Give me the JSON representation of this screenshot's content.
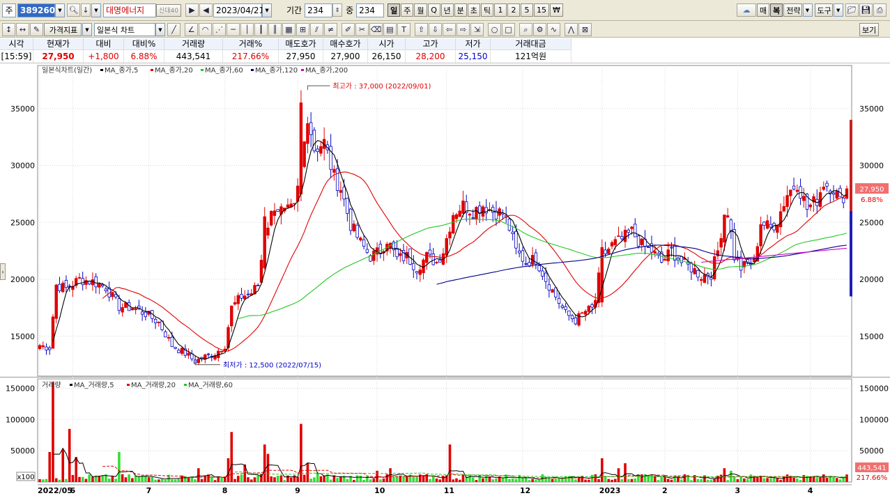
{
  "toolbar1": {
    "market_label": "주",
    "stock_code": "389260",
    "stock_name": "대명에너지",
    "stock_tag": "신대40",
    "date": "2023/04/21",
    "period_label": "기간",
    "period_value": "234",
    "count_label": "중",
    "count_value": "234",
    "intervals": [
      "일",
      "주",
      "월",
      "Q",
      "년",
      "분",
      "초",
      "틱",
      "1",
      "2",
      "5",
      "15",
      "₩"
    ],
    "active_interval": "일",
    "right_buttons": [
      "매",
      "복",
      "전략",
      "도구"
    ]
  },
  "toolbar2": {
    "price_indicator_label": "가격지표",
    "chart_type_label": "일본식 차트",
    "view_button": "보기"
  },
  "quote": {
    "headers": [
      "시각",
      "현재가",
      "대비",
      "대비%",
      "거래량",
      "거래%",
      "매도호가",
      "매수호가",
      "시가",
      "고가",
      "저가",
      "거래대금"
    ],
    "values": [
      "[15:59]",
      "27,950",
      "+1,800",
      "6.88%",
      "443,541",
      "217.66%",
      "27,950",
      "27,900",
      "26,150",
      "28,200",
      "25,150",
      "121억원"
    ]
  },
  "chart_data": [
    {
      "type": "candlestick",
      "title": "일본식차트(일간)",
      "legend": [
        {
          "name": "MA_종가,5",
          "color": "#000000"
        },
        {
          "name": "MA_종가,20",
          "color": "#e00000"
        },
        {
          "name": "MA_종가,60",
          "color": "#22c722"
        },
        {
          "name": "MA_종가,120",
          "color": "#00008b"
        },
        {
          "name": "MA_종가,200",
          "color": "#cc00cc"
        }
      ],
      "ylim": [
        11500,
        37800
      ],
      "y_ticks": [
        15000,
        20000,
        25000,
        30000,
        35000
      ],
      "x_labels": [
        "2022/05",
        "6",
        "7",
        "8",
        "9",
        "10",
        "11",
        "12",
        "2023",
        "2",
        "3",
        "4"
      ],
      "x_label_index": [
        0,
        10,
        33,
        56,
        78,
        102,
        123,
        146,
        170,
        189,
        211,
        233
      ],
      "annotations": {
        "high": "최고가 : 37,000 (2022/09/01)",
        "low": "최저가 : 12,500 (2022/07/15)"
      },
      "current_price_label": "27,950",
      "current_change_label": "6.88%",
      "ma120_start_index": 120,
      "ma200_start_index": 200,
      "anchors": [
        [
          0,
          14200
        ],
        [
          3,
          14000
        ],
        [
          5,
          19500
        ],
        [
          8,
          19200
        ],
        [
          12,
          20000
        ],
        [
          16,
          19800
        ],
        [
          20,
          19300
        ],
        [
          24,
          17600
        ],
        [
          28,
          17500
        ],
        [
          32,
          17000
        ],
        [
          36,
          16200
        ],
        [
          40,
          14200
        ],
        [
          44,
          13500
        ],
        [
          47,
          12800
        ],
        [
          50,
          13200
        ],
        [
          53,
          13500
        ],
        [
          56,
          14200
        ],
        [
          58,
          17500
        ],
        [
          61,
          18500
        ],
        [
          64,
          18800
        ],
        [
          66,
          19500
        ],
        [
          68,
          24000
        ],
        [
          71,
          26500
        ],
        [
          74,
          25800
        ],
        [
          77,
          26200
        ],
        [
          79,
          29500
        ],
        [
          81,
          34500
        ],
        [
          83,
          31500
        ],
        [
          86,
          32000
        ],
        [
          89,
          29000
        ],
        [
          91,
          28000
        ],
        [
          94,
          24800
        ],
        [
          97,
          23200
        ],
        [
          100,
          22000
        ],
        [
          103,
          22500
        ],
        [
          105,
          23500
        ],
        [
          108,
          21800
        ],
        [
          111,
          22000
        ],
        [
          114,
          21000
        ],
        [
          117,
          22000
        ],
        [
          120,
          21500
        ],
        [
          122,
          22500
        ],
        [
          125,
          25800
        ],
        [
          128,
          26500
        ],
        [
          131,
          26000
        ],
        [
          134,
          26500
        ],
        [
          137,
          26000
        ],
        [
          140,
          25800
        ],
        [
          142,
          24500
        ],
        [
          144,
          22500
        ],
        [
          147,
          21500
        ],
        [
          150,
          21800
        ],
        [
          153,
          20000
        ],
        [
          156,
          18500
        ],
        [
          159,
          17000
        ],
        [
          162,
          16400
        ],
        [
          165,
          17200
        ],
        [
          167,
          17400
        ],
        [
          168,
          18200
        ],
        [
          170,
          22000
        ],
        [
          173,
          23000
        ],
        [
          176,
          23500
        ],
        [
          179,
          24200
        ],
        [
          182,
          23000
        ],
        [
          185,
          22500
        ],
        [
          188,
          21500
        ],
        [
          191,
          22500
        ],
        [
          194,
          21500
        ],
        [
          197,
          21000
        ],
        [
          200,
          20300
        ],
        [
          203,
          20500
        ],
        [
          205,
          22500
        ],
        [
          207,
          25800
        ],
        [
          208,
          26000
        ],
        [
          210,
          22000
        ],
        [
          212,
          21000
        ],
        [
          214,
          21300
        ],
        [
          216,
          21500
        ],
        [
          218,
          25000
        ],
        [
          221,
          24500
        ],
        [
          223,
          25200
        ],
        [
          226,
          27500
        ],
        [
          229,
          28500
        ],
        [
          232,
          26200
        ],
        [
          235,
          27000
        ],
        [
          237,
          28500
        ],
        [
          240,
          28000
        ],
        [
          242,
          26800
        ],
        [
          244,
          27950
        ]
      ],
      "big_candles": [
        [
          68,
          21000,
          25500
        ],
        [
          79,
          27500,
          35500
        ],
        [
          170,
          18000,
          22800
        ]
      ]
    },
    {
      "type": "bar",
      "title": "거래량",
      "legend": [
        {
          "name": "MA_거래량,5",
          "color": "#000000"
        },
        {
          "name": "MA_거래량,20",
          "color": "#e00000"
        },
        {
          "name": "MA_거래량,60",
          "color": "#22c722"
        }
      ],
      "ylim": [
        0,
        165000
      ],
      "y_ticks": [
        50000,
        100000,
        150000
      ],
      "unit_label": "x100",
      "current_volume_label": "443,541",
      "current_ratio_label": "217.66%",
      "spikes": [
        [
          4,
          160000
        ],
        [
          3,
          48000
        ],
        [
          7,
          52000
        ],
        [
          9,
          85000
        ],
        [
          11,
          40000
        ],
        [
          24,
          48000
        ],
        [
          48,
          22000
        ],
        [
          57,
          38000
        ],
        [
          58,
          80000
        ],
        [
          62,
          28000
        ],
        [
          68,
          60000
        ],
        [
          69,
          45000
        ],
        [
          79,
          93000
        ],
        [
          81,
          30000
        ],
        [
          84,
          15000
        ],
        [
          102,
          18000
        ],
        [
          106,
          22000
        ],
        [
          124,
          60000
        ],
        [
          128,
          12000
        ],
        [
          170,
          38000
        ],
        [
          175,
          22000
        ],
        [
          177,
          30000
        ],
        [
          205,
          10000
        ],
        [
          207,
          22000
        ],
        [
          209,
          18000
        ],
        [
          226,
          12000
        ],
        [
          236,
          8000
        ],
        [
          244,
          12000
        ]
      ],
      "base_volume": 6000
    }
  ]
}
